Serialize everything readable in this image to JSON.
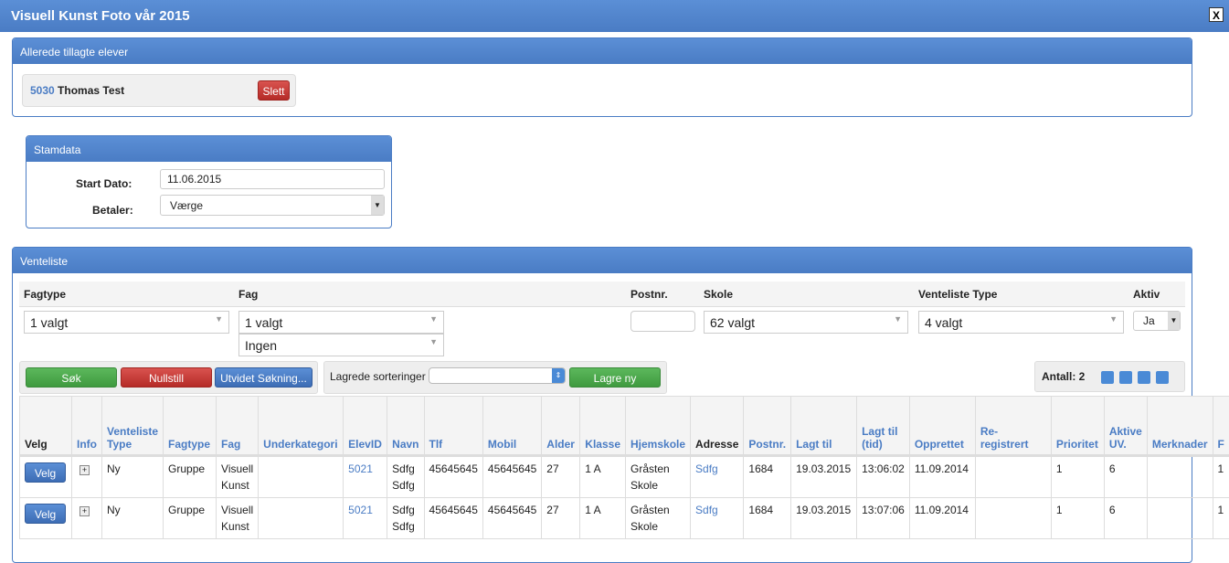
{
  "window": {
    "title": "Visuell Kunst Foto vår 2015",
    "close_label": "X"
  },
  "added": {
    "title": "Allerede tillagte elever",
    "student_id": "5030",
    "student_name": "Thomas Test",
    "delete_label": "Slett"
  },
  "stamdata": {
    "title": "Stamdata",
    "start_label": "Start Dato:",
    "start_value": "11.06.2015",
    "payer_label": "Betaler:",
    "payer_value": "Værge"
  },
  "waitlist": {
    "title": "Venteliste",
    "filters": {
      "fagtype_label": "Fagtype",
      "fagtype_value": "1 valgt",
      "fag_label": "Fag",
      "fag_value": "1 valgt",
      "fag_sub_value": "Ingen",
      "postnr_label": "Postnr.",
      "postnr_value": "",
      "skole_label": "Skole",
      "skole_value": "62 valgt",
      "type_label": "Venteliste Type",
      "type_value": "4 valgt",
      "aktiv_label": "Aktiv",
      "aktiv_value": "Ja"
    },
    "buttons": {
      "search": "Søk",
      "reset": "Nullstill",
      "advanced": "Utvidet Søkning...",
      "saved_label": "Lagrede sorteringer",
      "saved_value": "",
      "save_new": "Lagre ny"
    },
    "count": "Antall: 2",
    "toolbar_icons": [
      "list-icon",
      "export-icon",
      "email-icon",
      "print-icon"
    ],
    "columns": [
      "Velg",
      "Info",
      "Venteliste Type",
      "Fagtype",
      "Fag",
      "Underkategori",
      "ElevID",
      "Navn",
      "Tlf",
      "Mobil",
      "Alder",
      "Klasse",
      "Hjemskole",
      "Adresse",
      "Postnr.",
      "Lagt til",
      "Lagt til (tid)",
      "Opprettet",
      "Re-registrert",
      "Prioritet",
      "Aktive UV.",
      "Merknader",
      "F"
    ],
    "rows": [
      {
        "velg": "Velg",
        "type": "Ny",
        "fagtype": "Gruppe",
        "fag": "Visuell Kunst",
        "underkategori": "",
        "elevid": "5021",
        "navn": "Sdfg Sdfg",
        "tlf": "45645645",
        "mobil": "45645645",
        "alder": "27",
        "klasse": "1 A",
        "hjemskole": "Gråsten Skole",
        "adresse": "Sdfg",
        "postnr": "1684",
        "lagt_til": "19.03.2015",
        "lagt_tid": "13:06:02",
        "opprettet": "11.09.2014",
        "rereg": "",
        "prioritet": "1",
        "aktive": "6",
        "merknader": "",
        "f": "1"
      },
      {
        "velg": "Velg",
        "type": "Ny",
        "fagtype": "Gruppe",
        "fag": "Visuell Kunst",
        "underkategori": "",
        "elevid": "5021",
        "navn": "Sdfg Sdfg",
        "tlf": "45645645",
        "mobil": "45645645",
        "alder": "27",
        "klasse": "1 A",
        "hjemskole": "Gråsten Skole",
        "adresse": "Sdfg",
        "postnr": "1684",
        "lagt_til": "19.03.2015",
        "lagt_tid": "13:07:06",
        "opprettet": "11.09.2014",
        "rereg": "",
        "prioritet": "1",
        "aktive": "6",
        "merknader": "",
        "f": "1"
      }
    ]
  }
}
